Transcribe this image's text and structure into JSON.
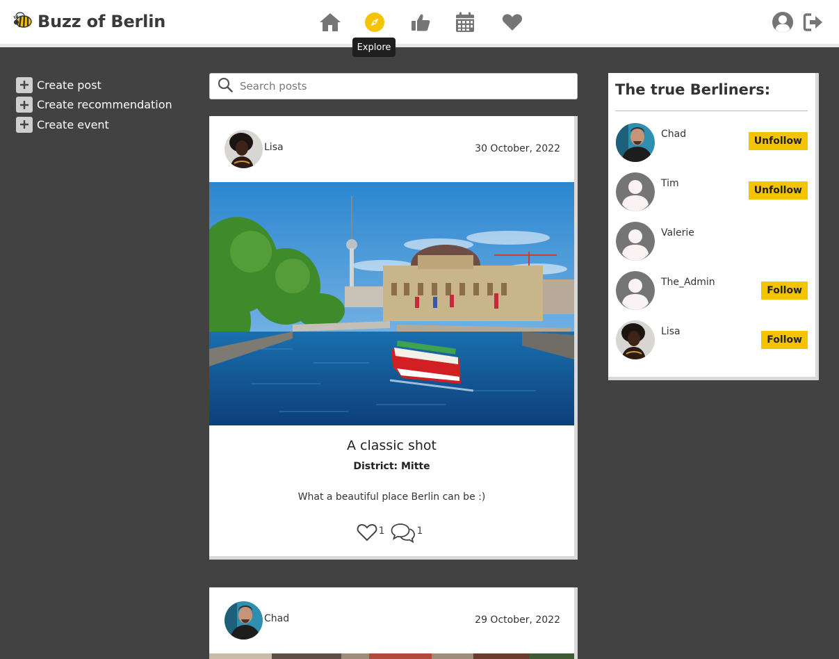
{
  "header": {
    "brand": "Buzz of Berlin",
    "tooltip": "Explore",
    "nav": [
      {
        "name": "home-icon",
        "label": "Home"
      },
      {
        "name": "compass-icon",
        "label": "Explore",
        "active": true
      },
      {
        "name": "thumbs-up-icon",
        "label": "Recommendations"
      },
      {
        "name": "calendar-icon",
        "label": "Events"
      },
      {
        "name": "heart-icon",
        "label": "Liked"
      }
    ],
    "accent": "#f5c400"
  },
  "sidebar": {
    "items": [
      {
        "label": "Create post"
      },
      {
        "label": "Create recommendation"
      },
      {
        "label": "Create event"
      }
    ]
  },
  "search": {
    "placeholder": "Search posts",
    "value": ""
  },
  "posts": [
    {
      "author": "Lisa",
      "date": "30 October, 2022",
      "title": "A classic shot",
      "district": "District: Mitte",
      "body": "What a beautiful place Berlin can be :)",
      "likes": "1",
      "comments": "1"
    },
    {
      "author": "Chad",
      "date": "29 October, 2022"
    }
  ],
  "panel": {
    "title": "The true Berliners:",
    "profiles": [
      {
        "name": "Chad",
        "button": "Unfollow"
      },
      {
        "name": "Tim",
        "button": "Unfollow"
      },
      {
        "name": "Valerie",
        "button": ""
      },
      {
        "name": "The_Admin",
        "button": "Follow"
      },
      {
        "name": "Lisa",
        "button": "Follow"
      }
    ]
  }
}
